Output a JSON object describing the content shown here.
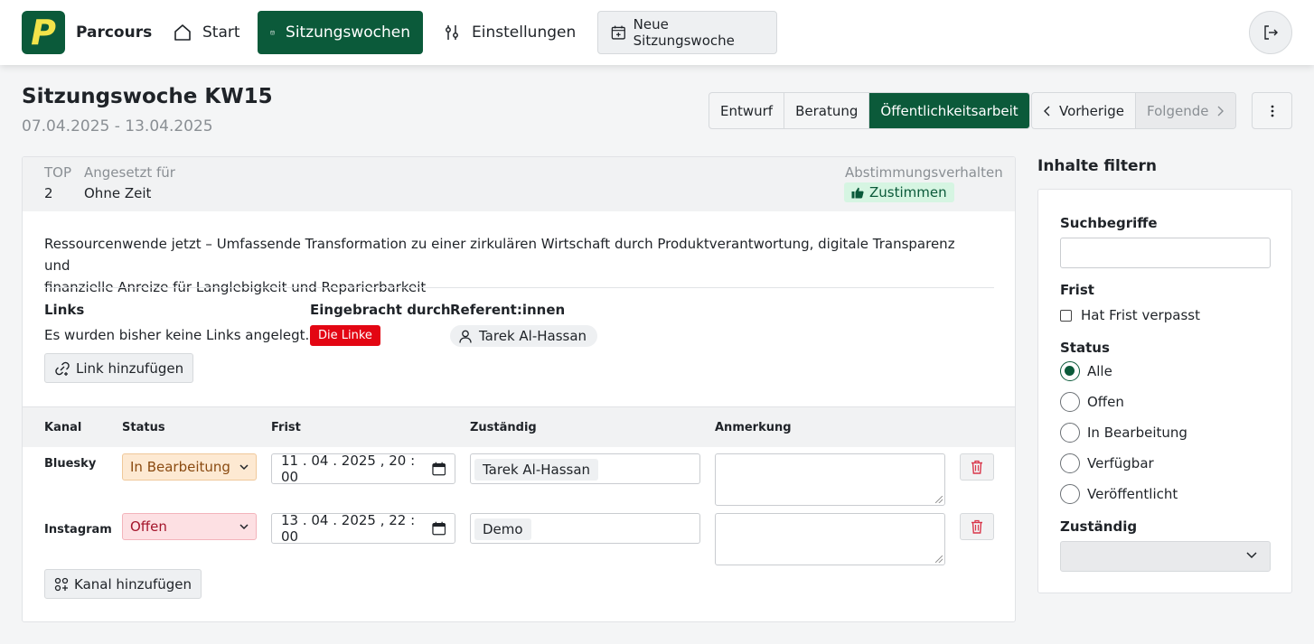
{
  "app": {
    "logo_letter": "P",
    "brand": "Parcours"
  },
  "nav": {
    "start": "Start",
    "sitzungswochen": "Sitzungswochen",
    "einstellungen": "Einstellungen",
    "neue_sitzungswoche": "Neue Sitzungswoche",
    "calendar_icon_number": "12"
  },
  "page": {
    "title": "Sitzungswoche KW15",
    "date_range": "07.04.2025 - 13.04.2025"
  },
  "phases": [
    {
      "label": "Entwurf",
      "active": false
    },
    {
      "label": "Beratung",
      "active": false
    },
    {
      "label": "Öffentlichkeitsarbeit",
      "active": true
    }
  ],
  "pager": {
    "prev": "Vorherige",
    "next": "Folgende"
  },
  "item": {
    "top_label": "TOP",
    "top_value": "2",
    "scheduled_label": "Angesetzt für",
    "scheduled_value": "Ohne Zeit",
    "vote_label": "Abstimmungsverhalten",
    "vote_value": "Zustimmen",
    "description_line1": "Ressourcenwende jetzt – Umfassende Transformation zu einer zirkulären Wirtschaft durch Produktverantwortung, digitale Transparenz und",
    "description_line2": "finanzielle Anreize für Langlebigkeit und Reparierbarkeit",
    "links_label": "Links",
    "links_empty": "Es wurden bisher keine Links angelegt.",
    "add_link": "Link hinzufügen",
    "introduced_label": "Eingebracht durch",
    "introduced_value": "Die Linke",
    "speakers_label": "Referent:innen",
    "speaker": "Tarek Al-Hassan"
  },
  "channels": {
    "headers": {
      "kanal": "Kanal",
      "status": "Status",
      "frist": "Frist",
      "zustaendig": "Zuständig",
      "anmerkung": "Anmerkung"
    },
    "rows": [
      {
        "kanal": "Bluesky",
        "status": "In Bearbeitung",
        "date": "11 . 04 . 2025 ,  20 : 00",
        "assignee": "Tarek Al-Hassan"
      },
      {
        "kanal": "Instagram",
        "status": "Offen",
        "date": "13 . 04 . 2025 ,  22 : 00",
        "assignee": "Demo"
      }
    ],
    "add_channel": "Kanal hinzufügen"
  },
  "filter": {
    "title": "Inhalte filtern",
    "search_label": "Suchbegriffe",
    "search_value": "",
    "frist_label": "Frist",
    "frist_checkbox": "Hat Frist verpasst",
    "status_label": "Status",
    "status_options": [
      "Alle",
      "Offen",
      "In Bearbeitung",
      "Verfügbar",
      "Veröffentlicht"
    ],
    "status_selected": "Alle",
    "zustaendig_label": "Zuständig"
  },
  "colors": {
    "primary": "#0b5a3a",
    "logo_letter": "#f3e44a",
    "party": "#e30613"
  }
}
